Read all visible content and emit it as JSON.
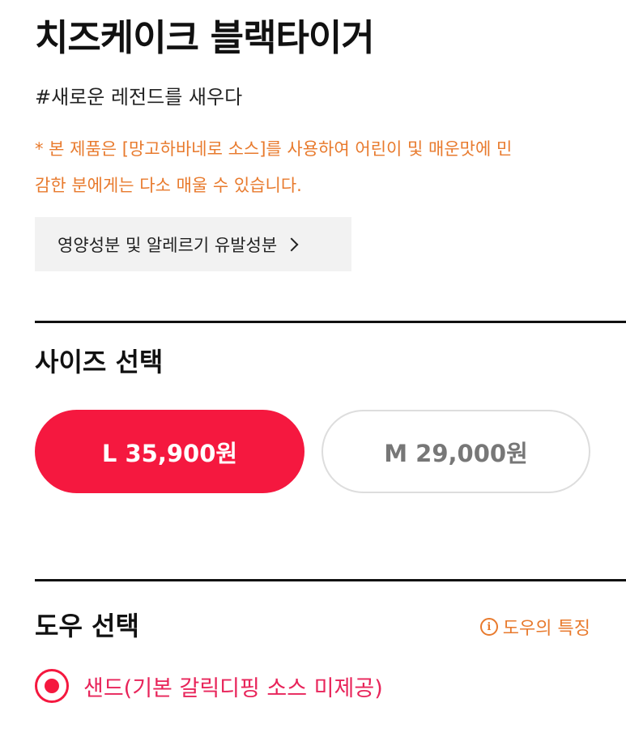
{
  "product": {
    "title": "치즈케이크 블랙타이거",
    "tagline": "#새로운 레전드를 새우다",
    "notice_line1": "* 본 제품은 [망고하바네로 소스]를 사용하여 어린이 및 매운맛에 민",
    "notice_line2": "감한 분에게는 다소 매울 수 있습니다.",
    "nutrition_label": "영양성분 및 알레르기 유발성분"
  },
  "size_section": {
    "title": "사이즈 선택",
    "options": [
      {
        "label": "L 35,900원",
        "selected": true
      },
      {
        "label": "M 29,000원",
        "selected": false
      }
    ]
  },
  "dough_section": {
    "title": "도우 선택",
    "info_icon_text": "i",
    "info_link": "도우의 특징",
    "options": [
      {
        "label": "샌드(기본 갈릭디핑 소스 미제공)",
        "selected": true
      }
    ]
  },
  "colors": {
    "accent": "#f5183f",
    "notice": "#e87a2d"
  },
  "icons": {
    "nutrition_chevron": "chevron-right-icon",
    "dough_info": "info-circle-icon",
    "dough_radio": "radio-selected-icon"
  }
}
